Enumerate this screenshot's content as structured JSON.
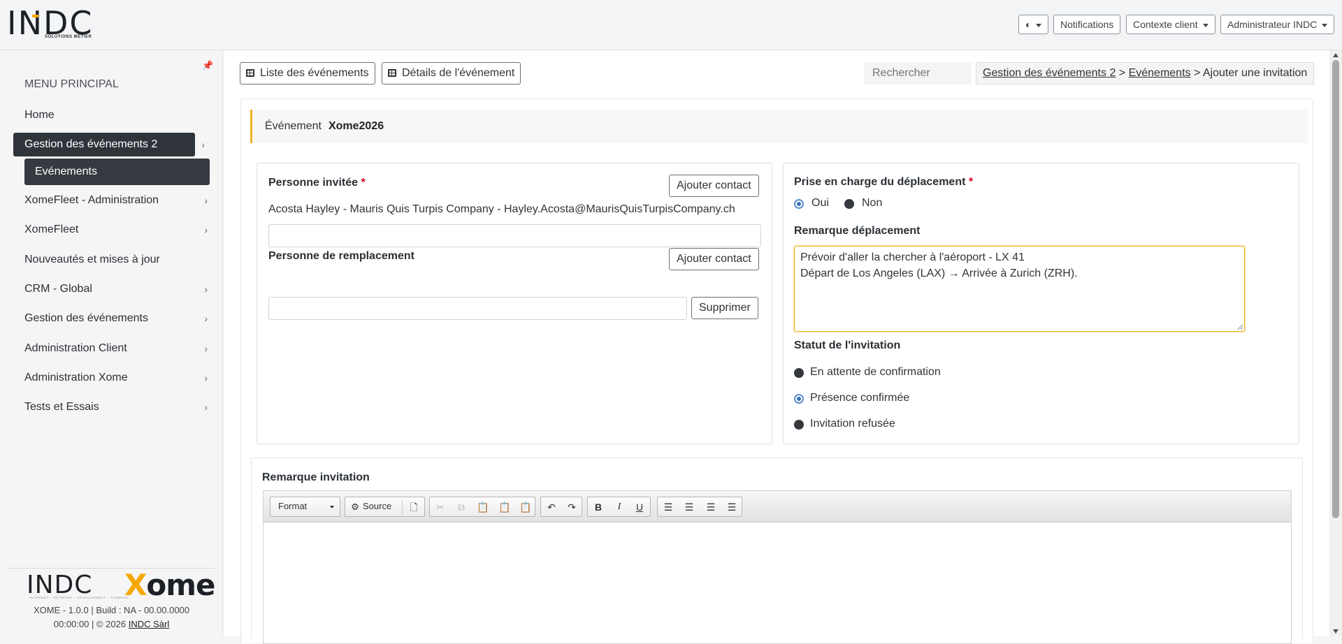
{
  "header": {
    "logo_text": "INDC",
    "logo_subtitle": "SOLUTIONS MÉTIER",
    "theme_toggle_label": "◐",
    "notifications_label": "Notifications",
    "client_context_label": "Contexte client",
    "user_menu_label": "Administrateur INDC"
  },
  "sidebar": {
    "pin_glyph": "📌",
    "title": "MENU PRINCIPAL",
    "items": [
      {
        "label": "Home",
        "chevron": ""
      },
      {
        "label": "Gestion des événements 2",
        "chevron": "›"
      },
      {
        "label": "XomeFleet - Administration",
        "chevron": "›"
      },
      {
        "label": "XomeFleet",
        "chevron": "›"
      },
      {
        "label": "Nouveautés et mises à jour",
        "chevron": ""
      },
      {
        "label": "CRM - Global",
        "chevron": "›"
      },
      {
        "label": "Gestion des événements",
        "chevron": "›"
      },
      {
        "label": "Administration Client",
        "chevron": "›"
      },
      {
        "label": "Administration Xome",
        "chevron": "›"
      },
      {
        "label": "Tests et Essais",
        "chevron": "›"
      }
    ],
    "subitem": "Evénements",
    "footer": {
      "logo_indc": "INDC",
      "logo_xome_x": "X",
      "logo_xome_rest": "ome",
      "logo_tagline": "INTERNET · NETWORK · DEVELOPMENT · COMPANY",
      "version_line": "XOME - 1.0.0 | Build : NA - 00.00.0000",
      "copyright_prefix": "00:00:00 | © 2026 ",
      "company_link": "INDC Sàrl"
    }
  },
  "toolbar": {
    "list_events": "Liste des événements",
    "event_details": "Détails de l'événement",
    "search_placeholder": "Rechercher"
  },
  "breadcrumb": {
    "crumb1": "Gestion des événements 2",
    "sep": " > ",
    "crumb2": "Evénements",
    "current": "Ajouter une invitation"
  },
  "event": {
    "label": "Événement",
    "name": "Xome2026"
  },
  "left_card": {
    "invited_label": "Personne invitée",
    "required_mark": "*",
    "add_contact": "Ajouter contact",
    "invited_value": "Acosta Hayley - Mauris Quis Turpis Company - Hayley.Acosta@MaurisQuisTurpisCompany.ch",
    "replacement_label": "Personne de remplacement",
    "add_contact_2": "Ajouter contact",
    "delete_button": "Supprimer"
  },
  "right_card": {
    "travel_label": "Prise en charge du déplacement",
    "required_mark": "*",
    "yes": "Oui",
    "no": "Non",
    "travel_selected": "Oui",
    "remark_label": "Remarque déplacement",
    "remark_value": "Prévoir d'aller la chercher à l'aéroport - LX 41\nDépart de Los Angeles (LAX) → Arrivée à Zurich (ZRH).",
    "status_label": "Statut de l'invitation",
    "status_options": [
      "En attente de confirmation",
      "Présence confirmée",
      "Invitation refusée"
    ],
    "status_selected": "Présence confirmée"
  },
  "invitation_remark": {
    "label": "Remarque invitation",
    "format_label": "Format",
    "source_label": "Source"
  }
}
